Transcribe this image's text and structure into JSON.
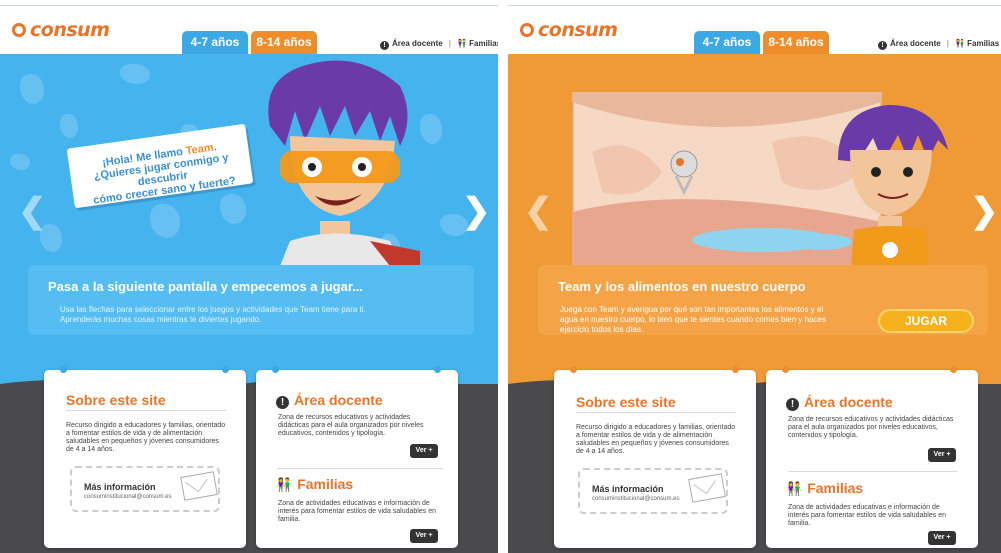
{
  "brand": {
    "logo": "consum",
    "accent": "#e8742a",
    "blue": "#45b3ee",
    "orange": "#f09a36"
  },
  "tabs": [
    {
      "label": "4-7 años"
    },
    {
      "label": "8-14 años"
    }
  ],
  "top_links": {
    "docente": "Área docente",
    "familias": "Familias"
  },
  "left": {
    "speech": {
      "line1": "¡Hola! Me llamo ",
      "name": "Team",
      "line1_end": ".",
      "line2": "¿Quieres jugar conmigo y descubrir",
      "line3": "cómo crecer sano y fuerte?"
    },
    "banner": {
      "title": "Pasa a la siguiente pantalla y empecemos a jugar...",
      "desc": "Usa las flechas para seleccionar entre los juegos y actividades que Team tiene para ti. Aprenderás muchas cosas mientras te diviertes jugando."
    }
  },
  "right": {
    "banner": {
      "title": "Team y los alimentos en nuestro cuerpo",
      "desc": "Juega con Team y averigua por qué son tan importantes los alimentos y el agua en nuestro cuerpo, lo bien que te sientes cuando comes bien y haces ejercicio todos los días.",
      "button": "JUGAR"
    }
  },
  "cards": {
    "site": {
      "title": "Sobre este site",
      "text": "Recurso dirigido a educadores y familias, orientado a fomentar estilos de vida y de alimentación saludables en pequeños y jóvenes consumidores de 4 a 14 años.",
      "more": "Más información",
      "email": "consuminstitucional@consum.es"
    },
    "docente": {
      "title": "Área docente",
      "text": "Zona de recursos educativos y actividades didácticas para el aula organizados por niveles educativos, contenidos y tipología.",
      "button": "Ver +"
    },
    "familias": {
      "title": "Familias",
      "text": "Zona de actividades educativas e información de interés para fomentar estilos de vida saludables en familia.",
      "button": "Ver +"
    }
  }
}
